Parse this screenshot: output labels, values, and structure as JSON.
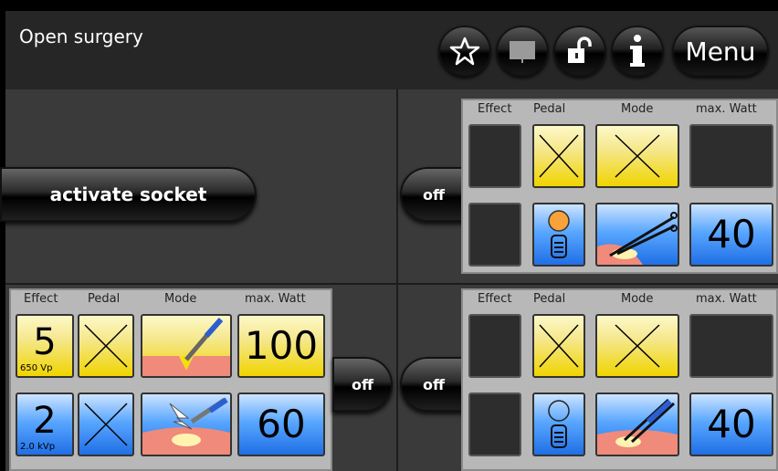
{
  "header": {
    "title": "Open surgery",
    "menu_label": "Menu",
    "icons": [
      "star-icon",
      "book-icon",
      "unlock-icon",
      "info-icon"
    ]
  },
  "panel_headers": {
    "effect": "Effect",
    "pedal": "Pedal",
    "mode": "Mode",
    "max_watt": "max. Watt"
  },
  "socket_top_left": {
    "activate_label": "activate socket"
  },
  "socket_top_right": {
    "off_label": "off",
    "row1": {
      "effect": "",
      "max_watt": ""
    },
    "row2": {
      "effect": "",
      "max_watt": "40"
    }
  },
  "socket_bottom_left": {
    "off_label": "off",
    "row1": {
      "effect": "5",
      "effect_sub": "650 Vp",
      "max_watt": "100"
    },
    "row2": {
      "effect": "2",
      "effect_sub": "2.0 kVp",
      "max_watt": "60"
    }
  },
  "socket_bottom_right": {
    "off_label": "off",
    "row1": {
      "effect": "",
      "max_watt": ""
    },
    "row2": {
      "effect": "",
      "max_watt": "40"
    }
  },
  "colors": {
    "yellow": "#f0d400",
    "blue": "#1f6fe6",
    "header_bg": "#262626"
  }
}
